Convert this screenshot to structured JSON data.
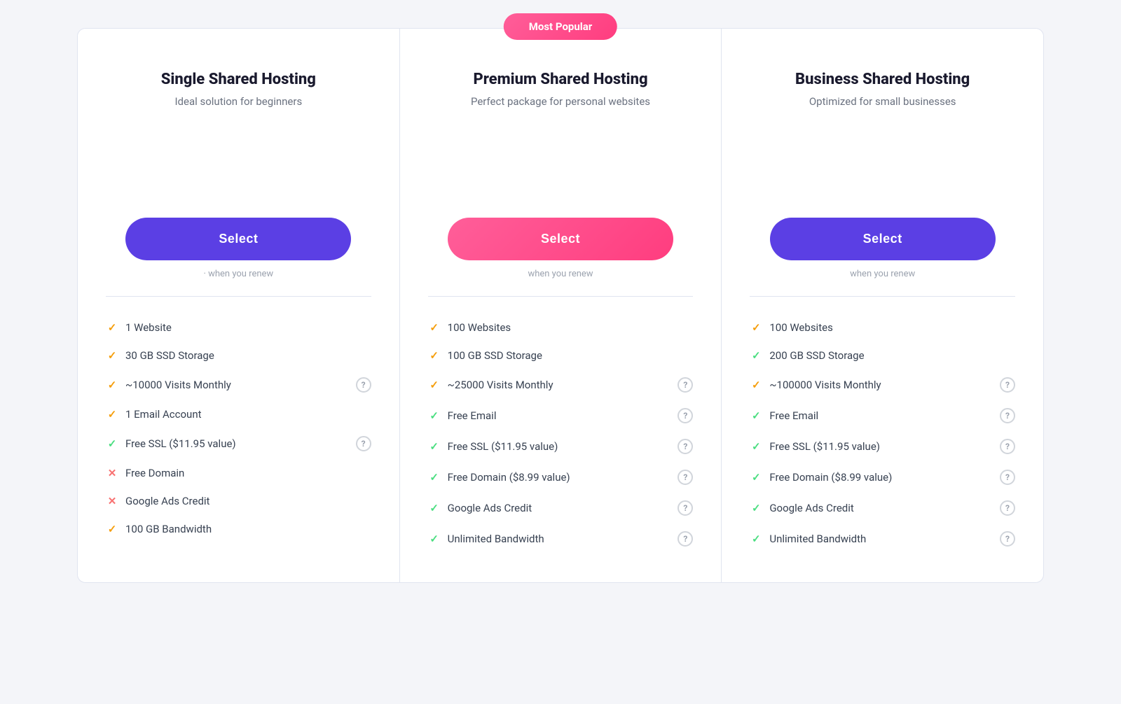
{
  "badge": {
    "label": "Most Popular"
  },
  "plans": [
    {
      "id": "single",
      "name": "Single Shared Hosting",
      "description": "Ideal solution for beginners",
      "button_label": "Select",
      "button_style": "purple",
      "renew_text": "· when you renew",
      "is_popular": false,
      "features": [
        {
          "icon": "orange-check",
          "text": "1 Website",
          "has_help": false
        },
        {
          "icon": "orange-check",
          "text": "30 GB SSD Storage",
          "has_help": false
        },
        {
          "icon": "orange-check",
          "text": "~10000 Visits Monthly",
          "has_help": true
        },
        {
          "icon": "orange-check",
          "text": "1 Email Account",
          "has_help": false
        },
        {
          "icon": "green-check",
          "text": "Free SSL ($11.95 value)",
          "has_help": true
        },
        {
          "icon": "red-x",
          "text": "Free Domain",
          "has_help": false
        },
        {
          "icon": "red-x",
          "text": "Google Ads Credit",
          "has_help": false
        },
        {
          "icon": "orange-check",
          "text": "100 GB Bandwidth",
          "has_help": false
        }
      ]
    },
    {
      "id": "premium",
      "name": "Premium Shared Hosting",
      "description": "Perfect package for personal websites",
      "button_label": "Select",
      "button_style": "pink",
      "renew_text": "when you renew",
      "is_popular": true,
      "features": [
        {
          "icon": "orange-check",
          "text": "100 Websites",
          "has_help": false
        },
        {
          "icon": "orange-check",
          "text": "100 GB SSD Storage",
          "has_help": false
        },
        {
          "icon": "orange-check",
          "text": "~25000 Visits Monthly",
          "has_help": true
        },
        {
          "icon": "green-check",
          "text": "Free Email",
          "has_help": true
        },
        {
          "icon": "green-check",
          "text": "Free SSL ($11.95 value)",
          "has_help": true
        },
        {
          "icon": "green-check",
          "text": "Free Domain ($8.99 value)",
          "has_help": true
        },
        {
          "icon": "green-check",
          "text": "Google Ads Credit",
          "has_help": true
        },
        {
          "icon": "green-check",
          "text": "Unlimited Bandwidth",
          "has_help": true
        }
      ]
    },
    {
      "id": "business",
      "name": "Business Shared Hosting",
      "description": "Optimized for small businesses",
      "button_label": "Select",
      "button_style": "purple",
      "renew_text": "when you renew",
      "is_popular": false,
      "features": [
        {
          "icon": "orange-check",
          "text": "100 Websites",
          "has_help": false
        },
        {
          "icon": "green-check",
          "text": "200 GB SSD Storage",
          "has_help": false
        },
        {
          "icon": "orange-check",
          "text": "~100000 Visits Monthly",
          "has_help": true
        },
        {
          "icon": "green-check",
          "text": "Free Email",
          "has_help": true
        },
        {
          "icon": "green-check",
          "text": "Free SSL ($11.95 value)",
          "has_help": true
        },
        {
          "icon": "green-check",
          "text": "Free Domain ($8.99 value)",
          "has_help": true
        },
        {
          "icon": "green-check",
          "text": "Google Ads Credit",
          "has_help": true
        },
        {
          "icon": "green-check",
          "text": "Unlimited Bandwidth",
          "has_help": true
        }
      ]
    }
  ]
}
